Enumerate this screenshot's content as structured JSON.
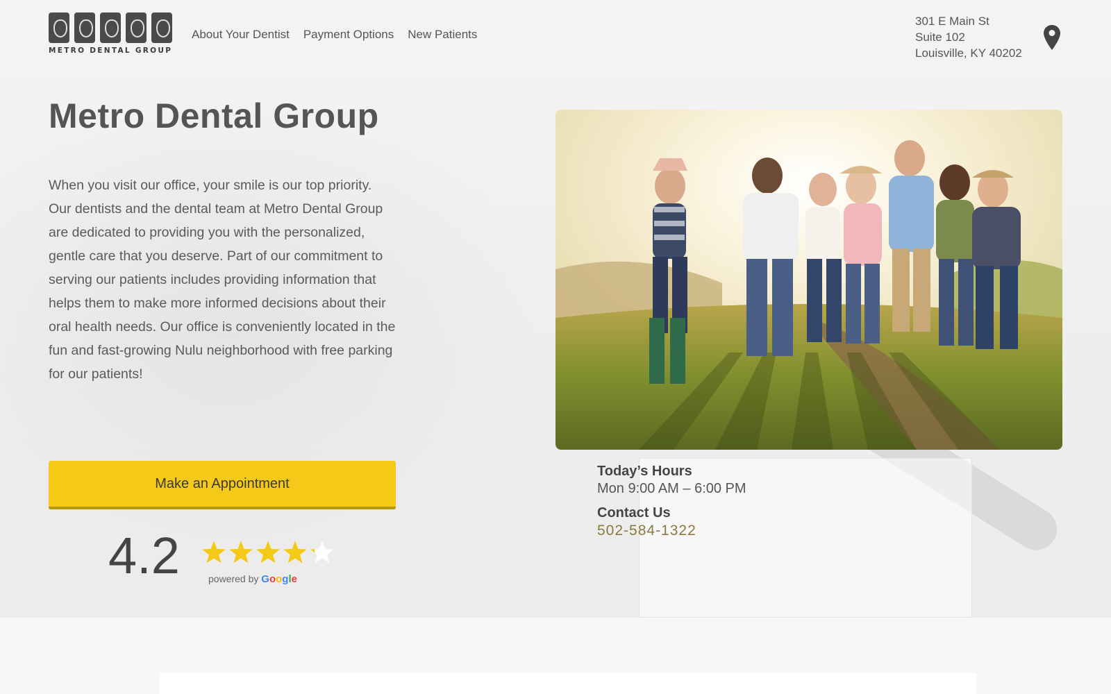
{
  "header": {
    "logo_text": "METRO DENTAL GROUP",
    "nav": [
      {
        "label": "About Your Dentist"
      },
      {
        "label": "Payment Options"
      },
      {
        "label": "New Patients"
      }
    ],
    "address": {
      "line1": "301 E Main St",
      "line2": "Suite 102",
      "line3": "Louisville, KY 40202"
    },
    "location_icon": "map-pin-icon"
  },
  "hero": {
    "title": "Metro Dental Group",
    "intro": "When you visit our office, your smile is our top priority. Our dentists and the dental team at Metro Dental Group are dedicated to providing you with the personalized, gentle care that you deserve. Part of our commitment to serving our patients includes providing information that helps them to make more informed decisions about their oral health needs. Our office is conveniently located in the fun and fast-growing Nulu neighborhood with free parking for our patients!",
    "cta_label": "Make an Appointment",
    "rating": {
      "value": "4.2",
      "stars": 4.2,
      "max_stars": 5,
      "powered_by": "powered by",
      "provider": "Google"
    }
  },
  "info": {
    "hours_label": "Today’s Hours",
    "hours_value": "Mon 9:00 AM – 6:00 PM",
    "contact_label": "Contact Us",
    "phone": "502-584-1322"
  },
  "colors": {
    "accent": "#f5c918",
    "accent_dark": "#b5960f",
    "text": "#555555",
    "phone": "#8a7a3e",
    "star": "#f5c918"
  }
}
